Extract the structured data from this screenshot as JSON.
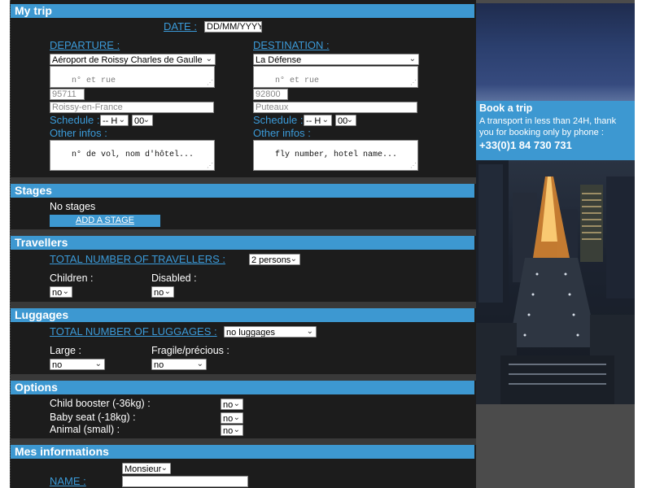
{
  "trip": {
    "title": "My trip",
    "date_label": "DATE :",
    "date_value": "DD/MM/YYYY",
    "departure": {
      "label": "DEPARTURE :",
      "location": "Aéroport de Roissy Charles de Gaulle",
      "address_placeholder": "n° et rue",
      "zip": "95711",
      "city": "Roissy-en-France",
      "schedule_label": "Schedule :",
      "hour": "-- H",
      "minute": "00",
      "other_label": "Other infos :",
      "other_placeholder": "n° de vol, nom d'hôtel..."
    },
    "destination": {
      "label": "DESTINATION :",
      "location": "La Défense",
      "address_placeholder": "n° et rue",
      "zip": "92800",
      "city": "Puteaux",
      "schedule_label": "Schedule :",
      "hour": "-- H",
      "minute": "00",
      "other_label": "Other infos :",
      "other_placeholder": "fly number, hotel name..."
    }
  },
  "stages": {
    "title": "Stages",
    "empty_text": "No stages",
    "add_button": "ADD A STAGE"
  },
  "travellers": {
    "title": "Travellers",
    "total_label": "TOTAL NUMBER OF TRAVELLERS :",
    "total_value": "2 persons",
    "children_label": "Children :",
    "children_value": "no",
    "disabled_label": "Disabled :",
    "disabled_value": "no"
  },
  "luggages": {
    "title": "Luggages",
    "total_label": "TOTAL NUMBER OF LUGGAGES :",
    "total_value": "no luggages",
    "large_label": "Large :",
    "large_value": "no",
    "fragile_label": "Fragile/précious :",
    "fragile_value": "no"
  },
  "options": {
    "title": "Options",
    "items": [
      {
        "label": "Child booster (-36kg) :",
        "value": "no"
      },
      {
        "label": "Baby seat (-18kg) :",
        "value": "no"
      },
      {
        "label": "Animal (small) :",
        "value": "no"
      }
    ]
  },
  "info": {
    "title": "Mes informations",
    "civility": "Monsieur",
    "name_label": "NAME :"
  },
  "sidebar": {
    "book_title": "Book a trip",
    "book_text": "A transport in less than 24H, thank you for booking only by phone :",
    "phone": "+33(0)1 84 730 731"
  },
  "colors": {
    "accent": "#3d98d1",
    "link": "#3b9ad8",
    "panel": "#1c1c1c",
    "separator": "#393939",
    "sidebar": "#4b4b4b"
  }
}
